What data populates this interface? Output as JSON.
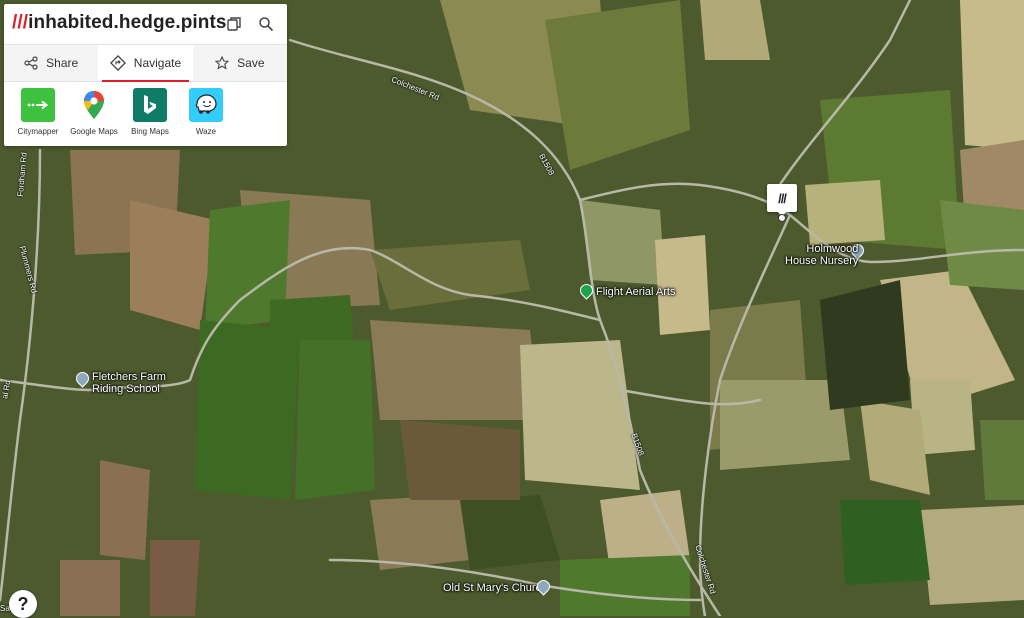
{
  "header": {
    "prefix": "///",
    "words": "inhabited.hedge.pints"
  },
  "tabs": [
    {
      "label": "Share",
      "icon": "share-icon"
    },
    {
      "label": "Navigate",
      "icon": "navigate-icon",
      "active": true
    },
    {
      "label": "Save",
      "icon": "star-icon"
    }
  ],
  "apps": [
    {
      "label": "Citymapper",
      "color": "#3ec13e"
    },
    {
      "label": "Google Maps",
      "color": "#ffffff"
    },
    {
      "label": "Bing Maps",
      "color": "#0f7c68"
    },
    {
      "label": "Waze",
      "color": "#33ccff"
    }
  ],
  "marker": {
    "text": "///"
  },
  "help": {
    "text": "?"
  },
  "places": [
    {
      "name": "Holmwood House Nursery",
      "line1": "Holmwood",
      "line2": "House Nursery"
    },
    {
      "name": "Flight Aerial Arts"
    },
    {
      "name": "Fletchers Farm Riding School",
      "line1": "Fletchers Farm",
      "line2": "Riding School"
    },
    {
      "name": "Old St Mary's Church"
    }
  ],
  "roads": [
    "Colchester Rd",
    "B1508",
    "B1508",
    "Colchester Rd",
    "Fordham Rd",
    "Plummers Rd",
    "al Rd",
    "Sa"
  ]
}
